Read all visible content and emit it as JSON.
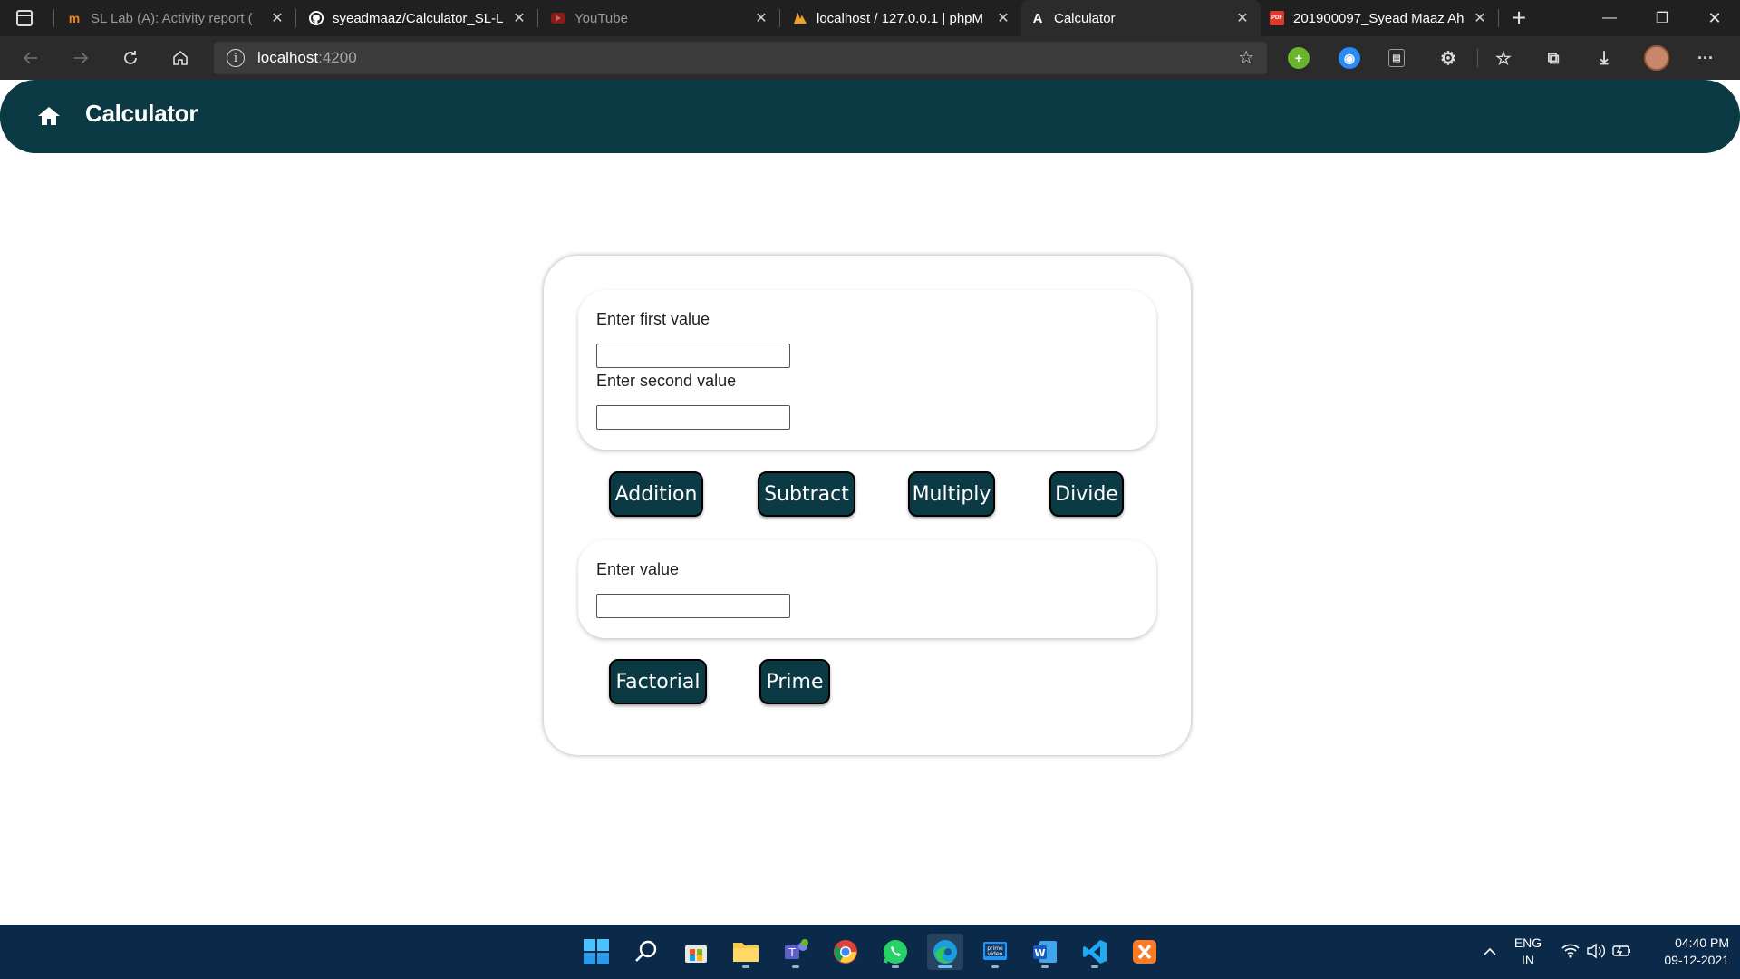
{
  "browser": {
    "tabs": [
      {
        "title": "SL Lab (A): Activity report (",
        "favicon": "moodle-icon",
        "active": false
      },
      {
        "title": "syeadmaaz/Calculator_SL-L",
        "favicon": "github-icon",
        "active": false
      },
      {
        "title": "YouTube",
        "favicon": "youtube-icon",
        "active": false
      },
      {
        "title": "localhost / 127.0.0.1 | phpM",
        "favicon": "phpmyadmin-icon",
        "active": false
      },
      {
        "title": "Calculator",
        "favicon": "angular-icon",
        "active": true
      },
      {
        "title": "201900097_Syead Maaz Ah",
        "favicon": "pdf-icon",
        "active": false
      }
    ],
    "favicon_letters": {
      "angular": "A",
      "pdf": "PDF"
    },
    "url": {
      "host": "localhost",
      "port": ":4200"
    },
    "window_controls": {
      "minimize": "—",
      "restore": "❐",
      "close": "✕"
    },
    "more_label": "···"
  },
  "app": {
    "title": "Calculator",
    "brand_color": "#0b3a45",
    "binary_panel": {
      "first_label": "Enter first value",
      "first_value": "",
      "second_label": "Enter second value",
      "second_value": ""
    },
    "binary_buttons": [
      "Addition",
      "Subtract",
      "Multiply",
      "Divide"
    ],
    "unary_panel": {
      "label": "Enter value",
      "value": ""
    },
    "unary_buttons": [
      "Factorial",
      "Prime"
    ]
  },
  "taskbar": {
    "icons": [
      "windows-start-icon",
      "search-icon",
      "microsoft-store-icon",
      "file-explorer-icon",
      "teams-icon",
      "chrome-icon",
      "whatsapp-icon",
      "edge-icon",
      "prime-video-icon",
      "word-icon",
      "vscode-icon",
      "xampp-icon"
    ],
    "language": "ENG",
    "region": "IN",
    "time": "04:40 PM",
    "date": "09-12-2021"
  }
}
